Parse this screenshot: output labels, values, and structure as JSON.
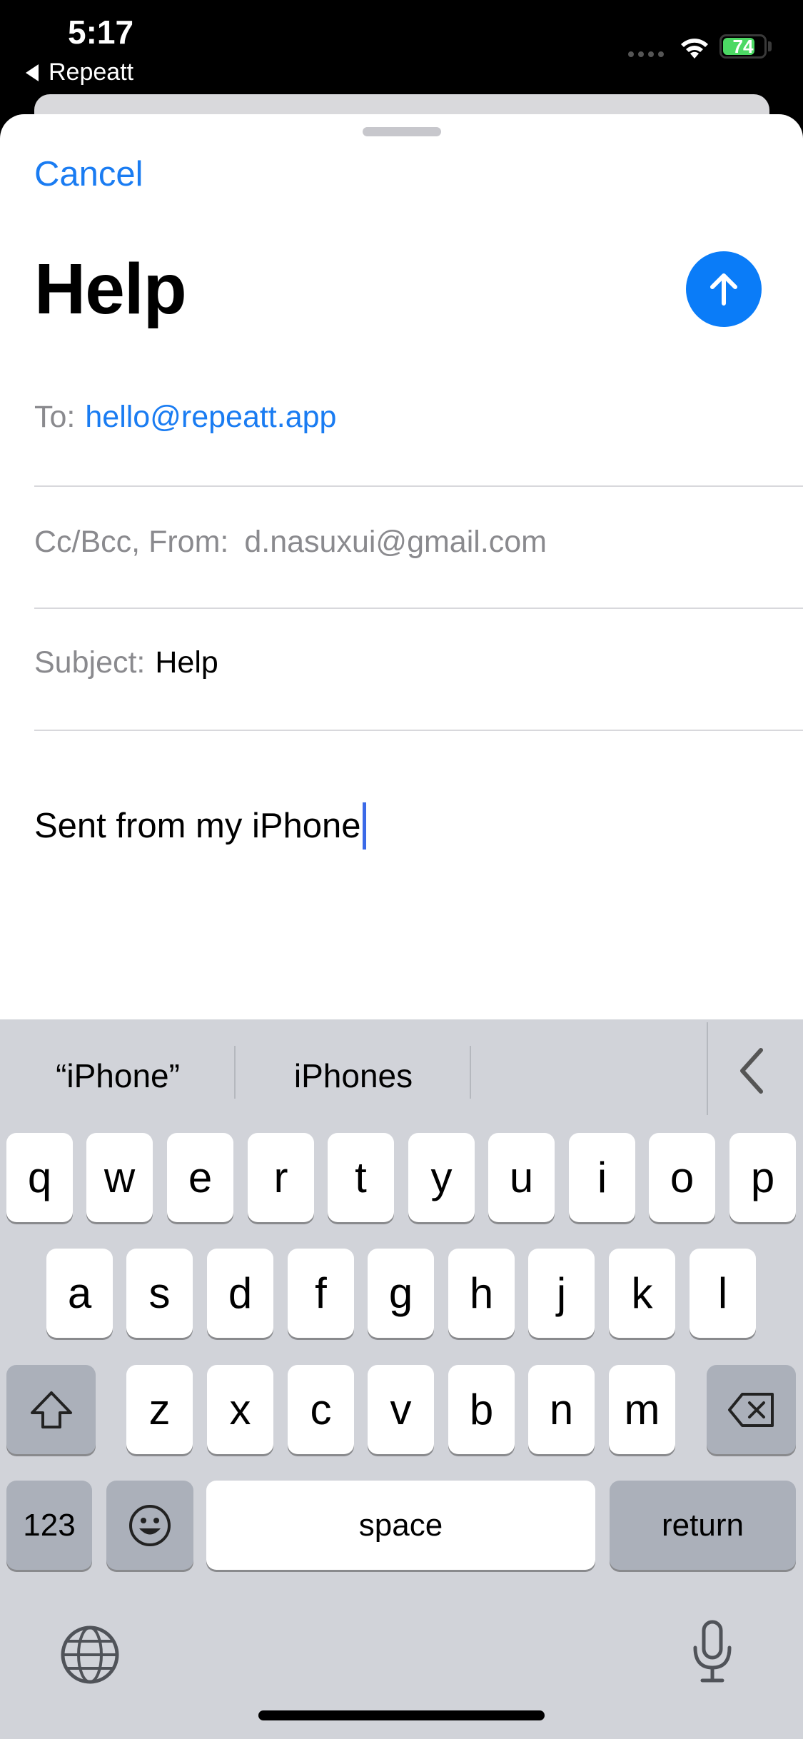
{
  "status": {
    "time": "5:17",
    "back_app": "Repeatt",
    "battery": "74"
  },
  "compose": {
    "cancel": "Cancel",
    "title": "Help",
    "to_label": "To:",
    "to_value": "hello@repeatt.app",
    "cc_label": "Cc/Bcc, From:",
    "cc_value": "d.nasuxui@gmail.com",
    "subject_label": "Subject:",
    "subject_value": "Help",
    "body": "Sent from my iPhone"
  },
  "keyboard": {
    "suggestions": [
      "“iPhone”",
      "iPhones"
    ],
    "row1": [
      "q",
      "w",
      "e",
      "r",
      "t",
      "y",
      "u",
      "i",
      "o",
      "p"
    ],
    "row2": [
      "a",
      "s",
      "d",
      "f",
      "g",
      "h",
      "j",
      "k",
      "l"
    ],
    "row3": [
      "z",
      "x",
      "c",
      "v",
      "b",
      "n",
      "m"
    ],
    "numbers": "123",
    "space": "space",
    "return": "return"
  },
  "colors": {
    "accent": "#1a7cf2",
    "send": "#0a7cf8",
    "keyboard_bg": "#d1d3d9"
  }
}
